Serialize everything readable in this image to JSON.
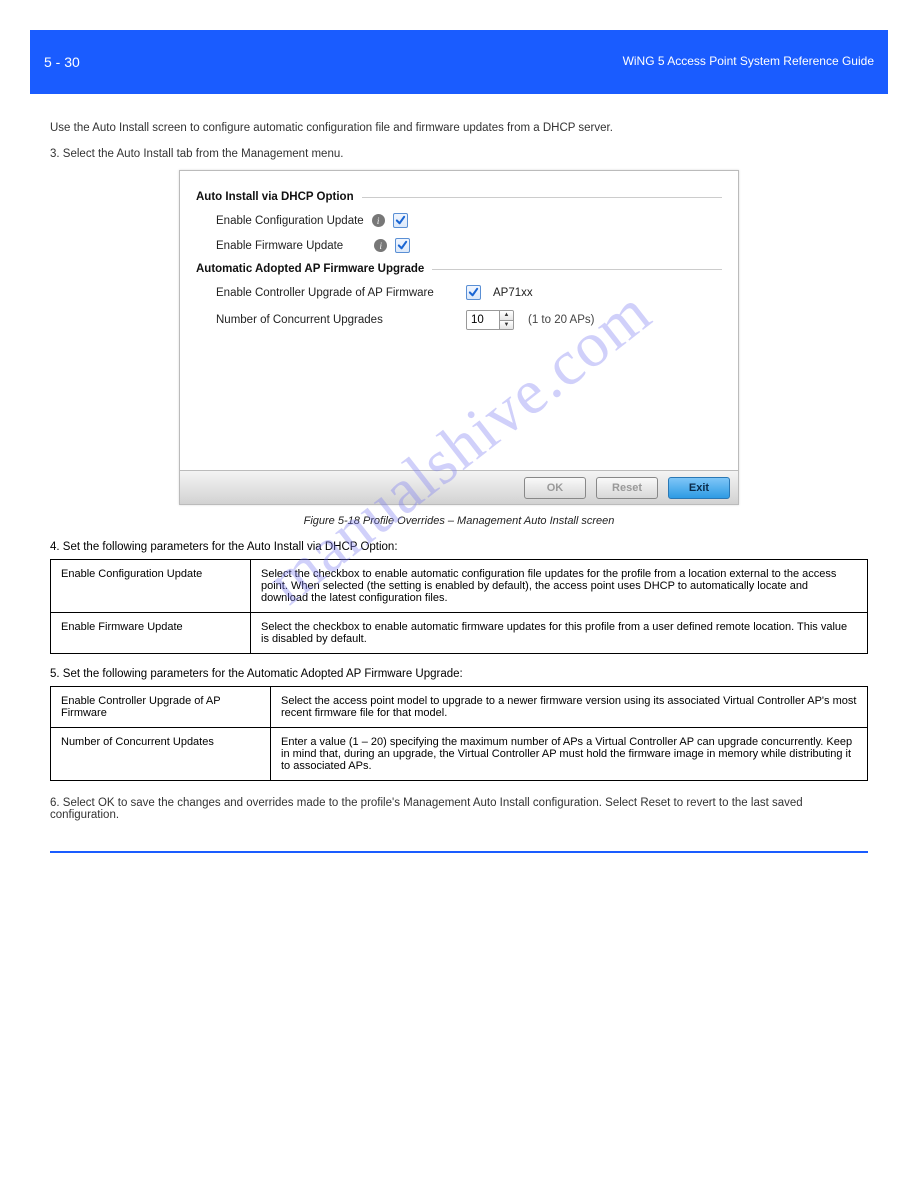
{
  "header": {
    "page_no": "5 - 30",
    "book": "WiNG 5 Access Point System Reference Guide",
    "watermark": "manualshive.com"
  },
  "intro": {
    "desc": "Use the Auto Install screen to configure automatic configuration file and firmware updates from a DHCP server.",
    "step3": "Select the Auto Install tab from the Management menu."
  },
  "panel": {
    "section1_title": "Auto Install via DHCP Option",
    "enable_cfg_update_label": "Enable Configuration Update",
    "enable_fw_update_label": "Enable Firmware Update",
    "section2_title": "Automatic Adopted AP Firmware Upgrade",
    "enable_ctrl_upgrade_label": "Enable Controller Upgrade of AP Firmware",
    "ap_model": "AP71xx",
    "num_concurrent_label": "Number of Concurrent Upgrades",
    "num_concurrent_value": "10",
    "num_concurrent_hint": "(1 to 20 APs)",
    "btn_ok": "OK",
    "btn_reset": "Reset",
    "btn_exit": "Exit"
  },
  "figure": {
    "caption": "Figure 5-18 Profile Overrides – Management Auto Install screen"
  },
  "step4": {
    "lead": "4. Set the following parameters for the Auto Install via DHCP Option:",
    "rows": [
      {
        "label": "Enable Configuration Update",
        "desc": "Select the checkbox to enable automatic configuration file updates for the profile from a location external to the access point. When selected (the setting is enabled by default), the access point uses DHCP to automatically locate and download the latest configuration files."
      },
      {
        "label": "Enable Firmware Update",
        "desc": "Select the checkbox to enable automatic firmware updates for this profile from a user defined remote location. This value is disabled by default."
      }
    ]
  },
  "step5": {
    "lead": "5. Set the following parameters for the Automatic Adopted AP Firmware Upgrade:",
    "rows": [
      {
        "label": "Enable Controller Upgrade of AP Firmware",
        "desc": "Select the access point model to upgrade to a newer firmware version using its associated Virtual Controller AP's most recent firmware file for that model."
      },
      {
        "label": "Number of Concurrent Updates",
        "desc": "Enter a value (1 – 20) specifying the maximum number of APs a Virtual Controller AP can upgrade concurrently. Keep in mind that, during an upgrade, the Virtual Controller AP must hold the firmware image in memory while distributing it to associated APs."
      }
    ]
  },
  "step6": "6. Select OK to save the changes and overrides made to the profile's Management Auto Install configuration. Select Reset to revert to the last saved configuration.",
  "footer": {
    "left": ""
  }
}
